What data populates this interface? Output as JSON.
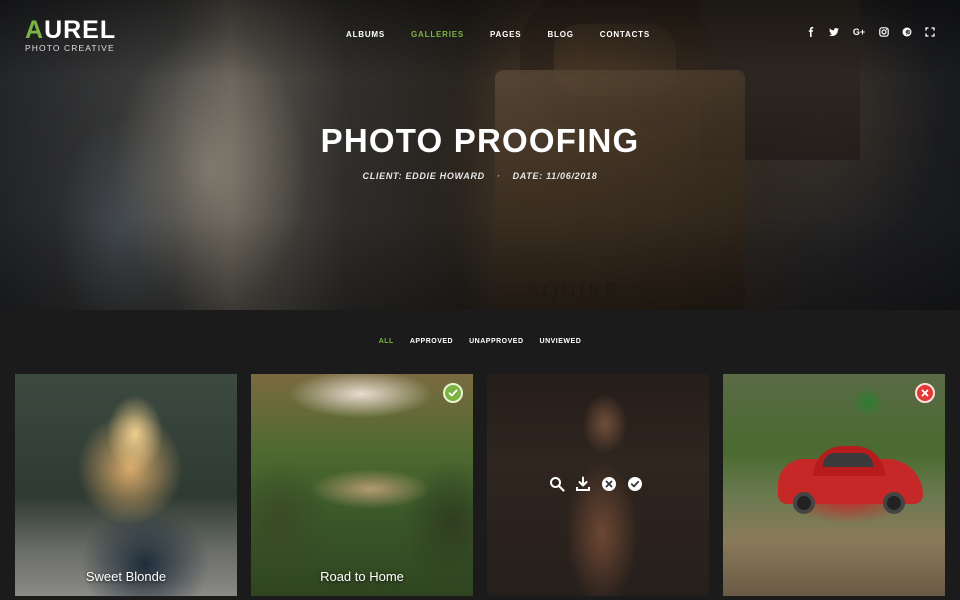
{
  "brand": {
    "logo_accent": "A",
    "logo_rest": "UREL",
    "tagline": "PHOTO CREATIVE",
    "accent_color": "#7cb342"
  },
  "nav": {
    "items": [
      {
        "label": "ALBUMS",
        "active": false
      },
      {
        "label": "GALLERIES",
        "active": true
      },
      {
        "label": "PAGES",
        "active": false
      },
      {
        "label": "BLOG",
        "active": false
      },
      {
        "label": "CONTACTS",
        "active": false
      }
    ]
  },
  "social": {
    "icons": [
      "facebook-icon",
      "twitter-icon",
      "google-plus-icon",
      "instagram-icon",
      "pinterest-icon",
      "fullscreen-icon"
    ]
  },
  "hero": {
    "title": "PHOTO PROOFING",
    "client": "CLIENT: EDDIE HOWARD",
    "separator": "·",
    "date": "DATE: 11/06/2018",
    "engraving": "SQUIRE"
  },
  "filters": {
    "items": [
      {
        "label": "ALL",
        "active": true
      },
      {
        "label": "APPROVED",
        "active": false
      },
      {
        "label": "UNAPPROVED",
        "active": false
      },
      {
        "label": "UNVIEWED",
        "active": false
      }
    ]
  },
  "gallery": {
    "tiles": [
      {
        "caption": "Sweet Blonde",
        "status": "none"
      },
      {
        "caption": "Road to Home",
        "status": "approved"
      },
      {
        "caption": "",
        "status": "hover",
        "actions": [
          "search-icon",
          "download-icon",
          "reject-icon",
          "approve-icon"
        ]
      },
      {
        "caption": "",
        "status": "rejected"
      }
    ],
    "status_colors": {
      "approved": "#7cb342",
      "rejected": "#e53935"
    }
  }
}
